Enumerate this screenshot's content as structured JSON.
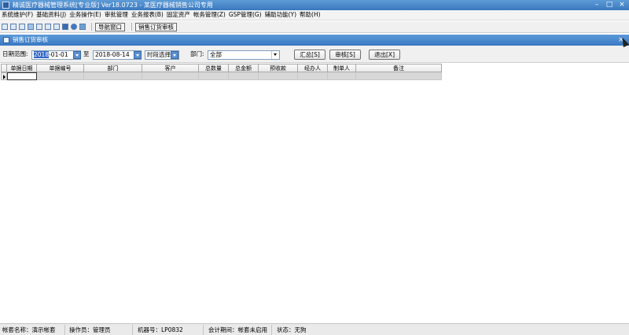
{
  "window": {
    "title": "精诚医疗器械管理系统[专业版] Ver18.0723  -  某医疗器械销售公司专用",
    "buttons": {
      "minimize": "–",
      "maximize": "□",
      "close": "×"
    }
  },
  "menu": [
    "系统维护(F)",
    "基础资料(J)",
    "业务操作(E)",
    "审批管理",
    "业务报表(B)",
    "固定资产",
    "帐务管理(Z)",
    "GSP管理(G)",
    "辅助功能(Y)",
    "帮助(H)"
  ],
  "toolbar": {
    "icons": [
      "list-icon",
      "list-icon",
      "table-icon",
      "window-icon",
      "tools-icon",
      "print-icon",
      "doc-icon",
      "save-icon",
      "help-icon",
      "exit-icon"
    ],
    "buttons": {
      "nav_window": "导航窗口",
      "sales_audit": "销售订货审核"
    }
  },
  "child_window": {
    "title": "销售订货审核",
    "close": "×"
  },
  "filter": {
    "date_range_label": "日期范围:",
    "date_from_selected": "2018",
    "date_from_rest": "-01-01",
    "to_label": "至",
    "date_to": "2018-08-14",
    "period_select": "时段选择",
    "dept_label": "部门:",
    "dept_value": "全部",
    "btn_summary": "汇总[S]",
    "btn_audit": "审核[S]",
    "btn_exit": "退出[X]"
  },
  "grid": {
    "columns": [
      "单据日期",
      "单据编号",
      "部门",
      "客户",
      "总数量",
      "总金额",
      "预收款",
      "经办人",
      "制单人",
      "备注"
    ]
  },
  "status": {
    "account": "帐套名称：演示帐套",
    "operator": "操作员：管理员",
    "machine": "机器号：LP0832",
    "period": "会计期间：帐套未启用",
    "state": "状态：无狗"
  }
}
